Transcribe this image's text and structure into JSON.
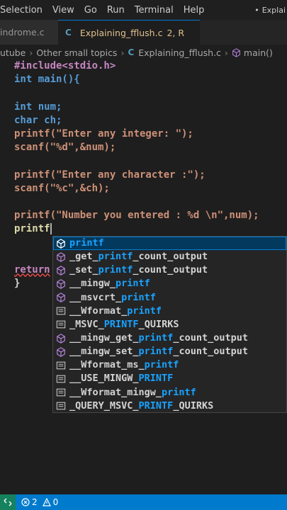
{
  "menubar": {
    "items": [
      "Selection",
      "View",
      "Go",
      "Run",
      "Terminal",
      "Help"
    ],
    "more": "•",
    "title": "Explai"
  },
  "tabs": [
    {
      "label": "indrome.c"
    },
    {
      "label": "Explaining_fflush.c",
      "status": "2, R"
    }
  ],
  "breadcrumb": [
    "utube",
    "Other small topics",
    "Explaining_fflush.c",
    "main()"
  ],
  "code": {
    "lines": [
      "#include<stdio.h>",
      "int main(){",
      "",
      "int num;",
      "char ch;",
      "printf(\"Enter any integer: \");",
      "scanf(\"%d\",&num);",
      "",
      "printf(\"Enter any character :\");",
      "scanf(\"%c\",&ch);",
      "",
      "printf(\"Number you entered : %d \\n\",num);",
      "printf",
      "",
      "",
      "return",
      "}"
    ]
  },
  "suggest": [
    {
      "pre": "",
      "hl": "printf",
      "post": "",
      "icon": "cube"
    },
    {
      "pre": "_get_",
      "hl": "printf",
      "post": "_count_output",
      "icon": "cube"
    },
    {
      "pre": "_set_",
      "hl": "printf",
      "post": "_count_output",
      "icon": "cube"
    },
    {
      "pre": "__mingw_",
      "hl": "printf",
      "post": "",
      "icon": "cube"
    },
    {
      "pre": "__msvcrt_",
      "hl": "printf",
      "post": "",
      "icon": "cube"
    },
    {
      "pre": "__Wformat_",
      "hl": "printf",
      "post": "",
      "icon": "text"
    },
    {
      "pre": "_MSVC_",
      "hl": "PRINTF",
      "post": "_QUIRKS",
      "icon": "text"
    },
    {
      "pre": "__mingw_get_",
      "hl": "printf",
      "post": "_count_output",
      "icon": "cube"
    },
    {
      "pre": "__mingw_set_",
      "hl": "printf",
      "post": "_count_output",
      "icon": "cube"
    },
    {
      "pre": "__Wformat_ms_",
      "hl": "printf",
      "post": "",
      "icon": "text"
    },
    {
      "pre": "__USE_MINGW_",
      "hl": "PRINTF",
      "post": "",
      "icon": "text"
    },
    {
      "pre": "__Wformat_mingw_",
      "hl": "printf",
      "post": "",
      "icon": "text"
    },
    {
      "pre": "_QUERY_MSVC_",
      "hl": "PRINTF",
      "post": "_QUIRKS",
      "icon": "text"
    }
  ],
  "status": {
    "errors": "2",
    "warnings": "0"
  },
  "colors": {
    "accent": "#007acc",
    "remote": "#16825d",
    "highlight": "#18a3ff",
    "selection": "#04395e"
  }
}
